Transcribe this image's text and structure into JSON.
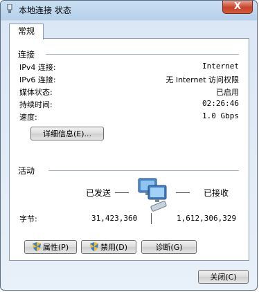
{
  "window": {
    "title": "本地连接 状态",
    "close_label": "X"
  },
  "tabs": [
    {
      "label": "常规"
    }
  ],
  "connection": {
    "section_title": "连接",
    "rows": [
      {
        "label": "IPv4 连接:",
        "value": "Internet"
      },
      {
        "label": "IPv6 连接:",
        "value": "无 Internet 访问权限"
      },
      {
        "label": "媒体状态:",
        "value": "已启用"
      },
      {
        "label": "持续时间:",
        "value": "02:26:46"
      },
      {
        "label": "速度:",
        "value": "1.0 Gbps"
      }
    ],
    "details_button": "详细信息(E)..."
  },
  "activity": {
    "section_title": "活动",
    "sent_label": "已发送",
    "received_label": "已接收",
    "bytes_label": "字节:",
    "bytes_sent": "31,423,360",
    "bytes_received": "1,612,306,329"
  },
  "buttons": {
    "properties": "属性(P)",
    "disable": "禁用(D)",
    "diagnose": "诊断(G)",
    "close": "关闭(C)"
  }
}
